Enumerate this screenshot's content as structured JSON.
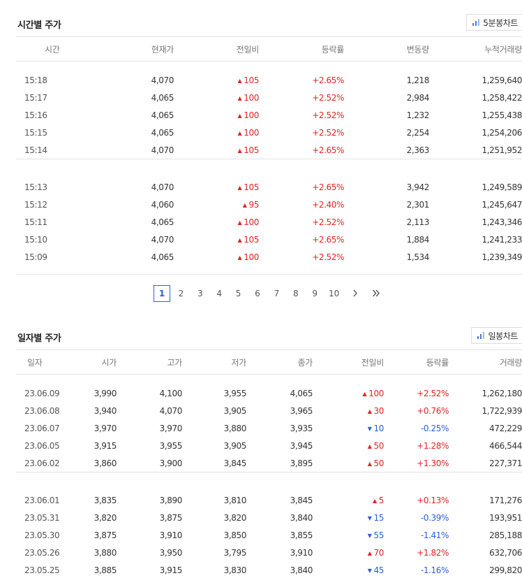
{
  "colors": {
    "up": "#e12323",
    "down": "#2a5fd8",
    "accent": "#2a5fd8"
  },
  "time_section": {
    "title": "시간별 주가",
    "chart_button": "5분봉차트",
    "columns": [
      "시간",
      "현재가",
      "전일비",
      "등락률",
      "변동량",
      "누적거래량"
    ],
    "groups": [
      [
        {
          "time": "15:18",
          "price": "4,070",
          "dir": "up",
          "change": "105",
          "rate": "+2.65%",
          "vol": "1,218",
          "acc": "1,259,640"
        },
        {
          "time": "15:17",
          "price": "4,065",
          "dir": "up",
          "change": "100",
          "rate": "+2.52%",
          "vol": "2,984",
          "acc": "1,258,422"
        },
        {
          "time": "15:16",
          "price": "4,065",
          "dir": "up",
          "change": "100",
          "rate": "+2.52%",
          "vol": "1,232",
          "acc": "1,255,438"
        },
        {
          "time": "15:15",
          "price": "4,065",
          "dir": "up",
          "change": "100",
          "rate": "+2.52%",
          "vol": "2,254",
          "acc": "1,254,206"
        },
        {
          "time": "15:14",
          "price": "4,070",
          "dir": "up",
          "change": "105",
          "rate": "+2.65%",
          "vol": "2,363",
          "acc": "1,251,952"
        }
      ],
      [
        {
          "time": "15:13",
          "price": "4,070",
          "dir": "up",
          "change": "105",
          "rate": "+2.65%",
          "vol": "3,942",
          "acc": "1,249,589"
        },
        {
          "time": "15:12",
          "price": "4,060",
          "dir": "up",
          "change": "95",
          "rate": "+2.40%",
          "vol": "2,301",
          "acc": "1,245,647"
        },
        {
          "time": "15:11",
          "price": "4,065",
          "dir": "up",
          "change": "100",
          "rate": "+2.52%",
          "vol": "2,113",
          "acc": "1,243,346"
        },
        {
          "time": "15:10",
          "price": "4,070",
          "dir": "up",
          "change": "105",
          "rate": "+2.65%",
          "vol": "1,884",
          "acc": "1,241,233"
        },
        {
          "time": "15:09",
          "price": "4,065",
          "dir": "up",
          "change": "100",
          "rate": "+2.52%",
          "vol": "1,534",
          "acc": "1,239,349"
        }
      ]
    ]
  },
  "pagination": {
    "pages": [
      "1",
      "2",
      "3",
      "4",
      "5",
      "6",
      "7",
      "8",
      "9",
      "10"
    ],
    "current": "1",
    "next_icon": "chevron-right-icon",
    "last_icon": "double-chevron-right-icon"
  },
  "daily_section": {
    "title": "일자별 주가",
    "chart_button": "일봉차트",
    "columns": [
      "일자",
      "시가",
      "고가",
      "저가",
      "종가",
      "전일비",
      "등락률",
      "거래량"
    ],
    "groups": [
      [
        {
          "date": "23.06.09",
          "open": "3,990",
          "high": "4,100",
          "low": "3,955",
          "close": "4,065",
          "dir": "up",
          "change": "100",
          "rate": "+2.52%",
          "vol": "1,262,180"
        },
        {
          "date": "23.06.08",
          "open": "3,940",
          "high": "4,070",
          "low": "3,905",
          "close": "3,965",
          "dir": "up",
          "change": "30",
          "rate": "+0.76%",
          "vol": "1,722,939"
        },
        {
          "date": "23.06.07",
          "open": "3,970",
          "high": "3,970",
          "low": "3,880",
          "close": "3,935",
          "dir": "down",
          "change": "10",
          "rate": "-0.25%",
          "vol": "472,229"
        },
        {
          "date": "23.06.05",
          "open": "3,915",
          "high": "3,955",
          "low": "3,905",
          "close": "3,945",
          "dir": "up",
          "change": "50",
          "rate": "+1.28%",
          "vol": "466,544"
        },
        {
          "date": "23.06.02",
          "open": "3,860",
          "high": "3,900",
          "low": "3,845",
          "close": "3,895",
          "dir": "up",
          "change": "50",
          "rate": "+1.30%",
          "vol": "227,371"
        }
      ],
      [
        {
          "date": "23.06.01",
          "open": "3,835",
          "high": "3,890",
          "low": "3,810",
          "close": "3,845",
          "dir": "up",
          "change": "5",
          "rate": "+0.13%",
          "vol": "171,276"
        },
        {
          "date": "23.05.31",
          "open": "3,820",
          "high": "3,875",
          "low": "3,820",
          "close": "3,840",
          "dir": "down",
          "change": "15",
          "rate": "-0.39%",
          "vol": "193,951"
        },
        {
          "date": "23.05.30",
          "open": "3,875",
          "high": "3,910",
          "low": "3,850",
          "close": "3,855",
          "dir": "down",
          "change": "55",
          "rate": "-1.41%",
          "vol": "285,188"
        },
        {
          "date": "23.05.26",
          "open": "3,880",
          "high": "3,950",
          "low": "3,795",
          "close": "3,910",
          "dir": "up",
          "change": "70",
          "rate": "+1.82%",
          "vol": "632,706"
        },
        {
          "date": "23.05.25",
          "open": "3,885",
          "high": "3,915",
          "low": "3,830",
          "close": "3,840",
          "dir": "down",
          "change": "45",
          "rate": "-1.16%",
          "vol": "299,820"
        }
      ]
    ]
  }
}
